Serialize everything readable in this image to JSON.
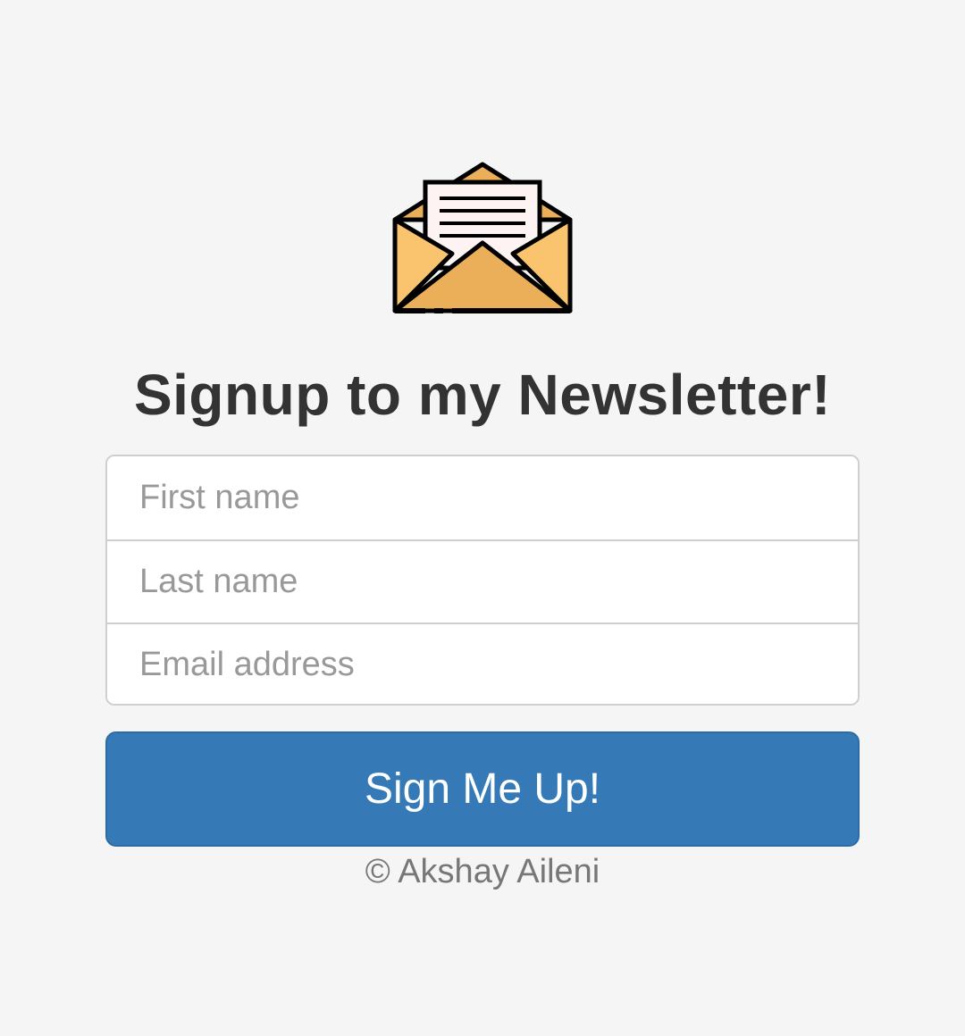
{
  "header": {
    "logo_icon": "open-envelope-icon",
    "title": "Signup to my Newsletter!"
  },
  "form": {
    "first_name": {
      "value": "",
      "placeholder": "First name"
    },
    "last_name": {
      "value": "",
      "placeholder": "Last name"
    },
    "email": {
      "value": "",
      "placeholder": "Email address"
    },
    "submit_label": "Sign Me Up!"
  },
  "footer": {
    "copyright": "© Akshay Aileni"
  },
  "colors": {
    "background": "#f5f5f5",
    "title": "#333333",
    "button": "#357ab7",
    "button_text": "#ffffff",
    "envelope": "#f9c46d",
    "envelope_dark": "#ebaf59",
    "letter": "#fdf3f3"
  }
}
